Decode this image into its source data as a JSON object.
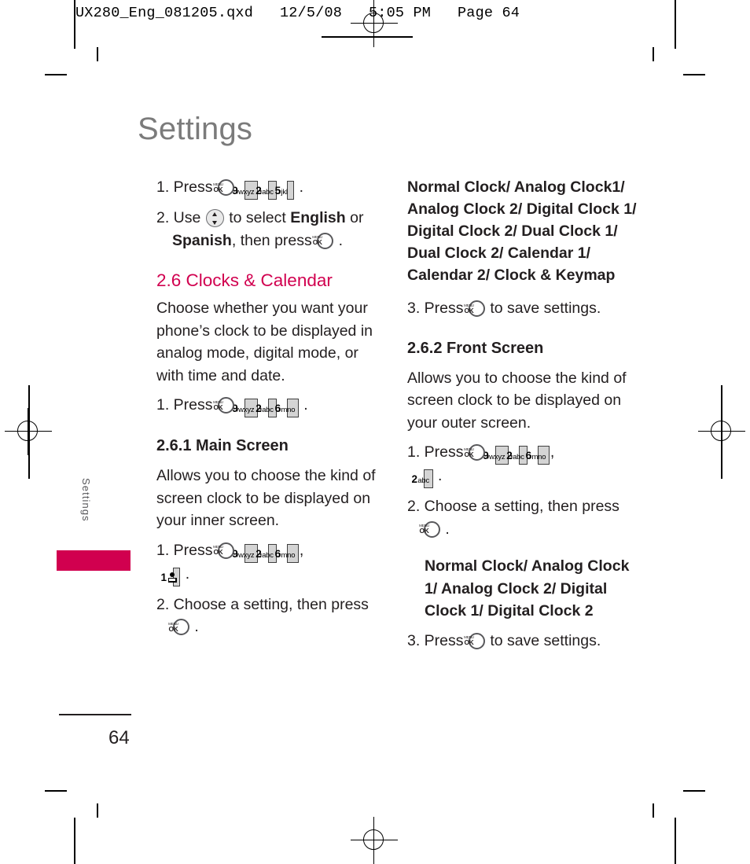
{
  "prepress": {
    "slug": "UX280_Eng_081205.qxd   12/5/08   5:05 PM   Page 64",
    "registration_mark_icon": "registration-target-icon"
  },
  "page": {
    "title": "Settings",
    "folio": "64",
    "side_tab_label": "Settings",
    "accent_color": "#d1004f",
    "title_color": "#7b7b7b"
  },
  "keys": {
    "ok_menu_top": "MENU",
    "ok_menu_bottom": "OK",
    "k9": {
      "digit": "9",
      "letters": "wxyz"
    },
    "k2": {
      "digit": "2",
      "letters": "abc"
    },
    "k5": {
      "digit": "5",
      "letters": "jkl"
    },
    "k6": {
      "digit": "6",
      "letters": "mno"
    },
    "k1": {
      "digit": "1",
      "letters": ""
    }
  },
  "left_column": {
    "lang_step1": {
      "prefix": "1. Press",
      "sep": ",",
      "end": "."
    },
    "lang_step2": {
      "prefix": "2. Use",
      "mid": "to select",
      "opt1": "English",
      "or": "or",
      "opt2": "Spanish",
      "tail": ", then press",
      "end": "."
    },
    "clocks_heading": "2.6 Clocks & Calendar",
    "clocks_body": "Choose whether you want your phone’s clock to be displayed in analog mode, digital mode, or with time and date.",
    "clocks_step1": {
      "prefix": "1. Press",
      "sep": ",",
      "end": "."
    },
    "main_heading": "2.6.1 Main Screen",
    "main_body": "Allows you to choose the kind of screen clock to be displayed on your inner screen.",
    "main_step1": {
      "prefix": "1. Press",
      "sep": ",",
      "end": "."
    },
    "main_step2": {
      "text": "2. Choose a setting, then press",
      "end": "."
    }
  },
  "right_column": {
    "clock_options": "Normal Clock/ Analog Clock1/ Analog Clock 2/ Digital Clock 1/ Digital Clock 2/ Dual Clock 1/ Dual Clock 2/ Calendar 1/ Calendar 2/ Clock & Keymap",
    "main_step3": {
      "prefix": "3. Press",
      "tail": "to save settings."
    },
    "front_heading": "2.6.2 Front Screen",
    "front_body": "Allows you to choose the kind of screen clock to be displayed on your outer screen.",
    "front_step1": {
      "prefix": "1. Press",
      "sep": ",",
      "end": "."
    },
    "front_step2": {
      "text": "2. Choose a setting, then press",
      "end": "."
    },
    "front_options": "Normal Clock/ Analog Clock 1/ Analog Clock 2/ Digital Clock 1/ Digital Clock 2",
    "front_step3": {
      "prefix": "3. Press",
      "tail": "to save settings."
    }
  }
}
